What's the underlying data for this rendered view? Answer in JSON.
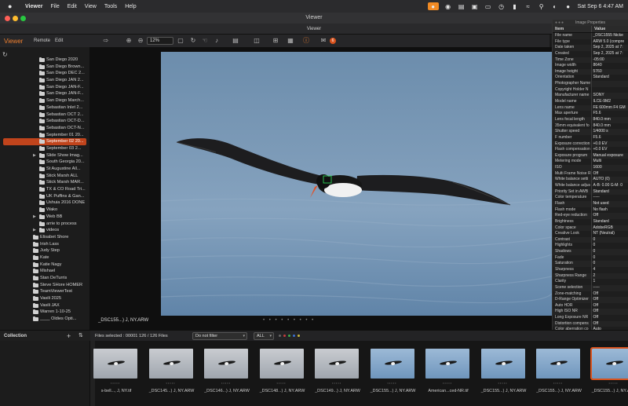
{
  "menubar": {
    "app_name": "Viewer",
    "items": [
      "File",
      "Edit",
      "View",
      "Tools",
      "Help"
    ],
    "clock": "Sat Sep 6  4:47 AM"
  },
  "window": {
    "title": "Viewer",
    "subtitle": "Viewer"
  },
  "toolbar": {
    "brand": "Viewer",
    "remote": "Remote",
    "edit": "Edit",
    "zoom": "12%",
    "badge_count": "6"
  },
  "sidebar": {
    "items": [
      {
        "label": "San Diego 2020",
        "indent": 1,
        "chev": false,
        "selected": false
      },
      {
        "label": "San Diego Brown...",
        "indent": 1,
        "chev": false,
        "selected": false
      },
      {
        "label": "San Diego DEC 2...",
        "indent": 1,
        "chev": false,
        "selected": false
      },
      {
        "label": "San Diego JAN 2...",
        "indent": 1,
        "chev": false,
        "selected": false
      },
      {
        "label": "San Diego JAN-F...",
        "indent": 1,
        "chev": false,
        "selected": false
      },
      {
        "label": "San Diego JAN-F...",
        "indent": 1,
        "chev": false,
        "selected": false
      },
      {
        "label": "San Diego March...",
        "indent": 1,
        "chev": false,
        "selected": false
      },
      {
        "label": "Sebastian Inlet 2...",
        "indent": 1,
        "chev": false,
        "selected": false
      },
      {
        "label": "Sebastian OCT 2...",
        "indent": 1,
        "chev": false,
        "selected": false
      },
      {
        "label": "Sebastian OCT-D...",
        "indent": 1,
        "chev": false,
        "selected": false
      },
      {
        "label": "Sebastian OCT-N...",
        "indent": 1,
        "chev": false,
        "selected": false
      },
      {
        "label": "September 01 20...",
        "indent": 1,
        "chev": false,
        "selected": false
      },
      {
        "label": "September 02 20...",
        "indent": 1,
        "chev": false,
        "selected": true
      },
      {
        "label": "September 03 2...",
        "indent": 1,
        "chev": false,
        "selected": false
      },
      {
        "label": "Slide Show Imag...",
        "indent": 1,
        "chev": true,
        "selected": false
      },
      {
        "label": "South Georgia 20...",
        "indent": 1,
        "chev": false,
        "selected": false
      },
      {
        "label": "St Augustine All...",
        "indent": 1,
        "chev": false,
        "selected": false
      },
      {
        "label": "Stick Marsh ALL",
        "indent": 1,
        "chev": false,
        "selected": false
      },
      {
        "label": "Stick Marsh MAR...",
        "indent": 1,
        "chev": false,
        "selected": false
      },
      {
        "label": "TX & CO Road Tri...",
        "indent": 1,
        "chev": false,
        "selected": false
      },
      {
        "label": "UK Puffins & Gan...",
        "indent": 1,
        "chev": false,
        "selected": false
      },
      {
        "label": "Ushuia 2016 DONE",
        "indent": 1,
        "chev": false,
        "selected": false
      },
      {
        "label": "Wako",
        "indent": 1,
        "chev": false,
        "selected": false
      },
      {
        "label": "Web BB",
        "indent": 1,
        "chev": true,
        "selected": false
      },
      {
        "label": "arrie to process",
        "indent": 1,
        "chev": false,
        "selected": false
      },
      {
        "label": "videos",
        "indent": 1,
        "chev": true,
        "selected": false
      },
      {
        "label": "Elisabet Shore",
        "indent": 0,
        "chev": false,
        "selected": false
      },
      {
        "label": "Irish Lass",
        "indent": 0,
        "chev": false,
        "selected": false
      },
      {
        "label": "Judy Step",
        "indent": 0,
        "chev": false,
        "selected": false
      },
      {
        "label": "Kate",
        "indent": 0,
        "chev": false,
        "selected": false
      },
      {
        "label": "Katie Nagy",
        "indent": 0,
        "chev": false,
        "selected": false
      },
      {
        "label": "Mishael",
        "indent": 0,
        "chev": false,
        "selected": false
      },
      {
        "label": "Stan DeTurris",
        "indent": 0,
        "chev": false,
        "selected": false
      },
      {
        "label": "Steve SHore HOMER",
        "indent": 0,
        "chev": false,
        "selected": false
      },
      {
        "label": "TeamViewerTest",
        "indent": 0,
        "chev": false,
        "selected": false
      },
      {
        "label": "Vasili 2025",
        "indent": 0,
        "chev": false,
        "selected": false
      },
      {
        "label": "Vasili JAX",
        "indent": 0,
        "chev": false,
        "selected": false
      },
      {
        "label": "Warren 1-10-25",
        "indent": 0,
        "chev": false,
        "selected": false
      },
      {
        "label": "____ Oldies Opti...",
        "indent": 0,
        "chev": false,
        "selected": false
      }
    ],
    "collection_label": "Collection"
  },
  "viewer": {
    "caption": "_DSC155...) J, NY.ARW",
    "dots": "• • • • •  • • • •"
  },
  "properties": {
    "panel_title": "Image Properties",
    "col_item": "Item",
    "col_value": "Value",
    "rows": [
      [
        "File name",
        "_DSC1555 Nicke"
      ],
      [
        "File type",
        "ARW 5.0 (compre"
      ],
      [
        "Date taken",
        "Sep 2, 2025 at 7:"
      ],
      [
        "Created",
        "Sep 2, 2025 at 7:"
      ],
      [
        "Time Zone",
        "-05:00"
      ],
      [
        "Image width",
        "8640"
      ],
      [
        "Image height",
        "5760"
      ],
      [
        "Orientation",
        "Standard"
      ],
      [
        "Photographer Name",
        ""
      ],
      [
        "Copyright Holder N",
        ""
      ],
      [
        "Manufacturer name",
        "SONY"
      ],
      [
        "Model name",
        "ILCE-9M2"
      ],
      [
        "Lens name",
        "FE 600mm F4 GM"
      ],
      [
        "Max aperture",
        "F5.6"
      ],
      [
        "Lens focal length",
        "840.0 mm"
      ],
      [
        "35mm equivalent fo",
        "840.0 mm"
      ],
      [
        "Shutter speed",
        "1/4000 s"
      ],
      [
        "F number",
        "F5.6"
      ],
      [
        "Exposure correction",
        "+0.0 EV"
      ],
      [
        "Flash compensation",
        "+0.0 EV"
      ],
      [
        "Exposure program",
        "Manual exposure"
      ],
      [
        "Metering mode",
        "Multi"
      ],
      [
        "ISO",
        "1600"
      ],
      [
        "Multi Frame Noise R",
        "Off"
      ],
      [
        "White balance setti",
        "AUTO (0)"
      ],
      [
        "White balance adjus",
        "A-B: 0.00 G-M: 0"
      ],
      [
        "Priority Set in AWB",
        "Standard"
      ],
      [
        "Color temperature",
        "-----"
      ],
      [
        "Flash",
        "Not used"
      ],
      [
        "Flash mode",
        "No flash"
      ],
      [
        "Red-eye reduction",
        "Off"
      ],
      [
        "Brightness",
        "Standard"
      ],
      [
        "Color space",
        "AdobeRGB"
      ],
      [
        "Creative Look",
        "NT (Neutral)"
      ],
      [
        "Contrast",
        "0"
      ],
      [
        "Highlights",
        "0"
      ],
      [
        "Shadows",
        "0"
      ],
      [
        "Fade",
        "0"
      ],
      [
        "Saturation",
        "0"
      ],
      [
        "Sharpness",
        "4"
      ],
      [
        "Sharpness Range",
        "2"
      ],
      [
        "Clarity",
        "1"
      ],
      [
        "Scene selection",
        "-----"
      ],
      [
        "Zone-matching",
        "Off"
      ],
      [
        "D-Range Optimizer",
        "Off"
      ],
      [
        "Auto HDR",
        "Off"
      ],
      [
        "High ISO NR",
        "Off"
      ],
      [
        "Long Exposure NR",
        "Off"
      ],
      [
        "Distortion compens",
        "Off"
      ],
      [
        "Color aberration co",
        "Auto"
      ],
      [
        "Shading compensat",
        "Auto"
      ],
      [
        "Image Stabilization",
        "On"
      ],
      [
        "File Format",
        "RAW"
      ],
      [
        "Protect",
        "OFF"
      ]
    ]
  },
  "filesbar": {
    "status": "Files selected : 00001   126 / 126 Files",
    "filter": "Do not filter",
    "range": "ALL"
  },
  "filmstrip": {
    "thumbs": [
      {
        "caption": "s-bell..., J, NY.tif",
        "tone": "light",
        "selected": false
      },
      {
        "caption": "_DSC145...) J, NY.ARW",
        "tone": "light",
        "selected": false
      },
      {
        "caption": "_DSC146...) J, NY.ARW",
        "tone": "light",
        "selected": false
      },
      {
        "caption": "_DSC148...) J, NY.ARW",
        "tone": "light",
        "selected": false
      },
      {
        "caption": "_DSC149...) J, NY.ARW",
        "tone": "light",
        "selected": false
      },
      {
        "caption": "_DSC155...) J, NY.ARW",
        "tone": "blue",
        "selected": false
      },
      {
        "caption": "American...ced-NR.tif",
        "tone": "blue",
        "selected": false
      },
      {
        "caption": "_DSC155...) J, NY.ARW",
        "tone": "blue",
        "selected": false
      },
      {
        "caption": "_DSC155...) J, NY.ARW",
        "tone": "blue",
        "selected": false
      },
      {
        "caption": "_DSC155...) J, NY.ARW",
        "tone": "blue",
        "selected": true
      }
    ]
  },
  "colors": {
    "accent": "#c0441c",
    "brand": "#f08030"
  }
}
